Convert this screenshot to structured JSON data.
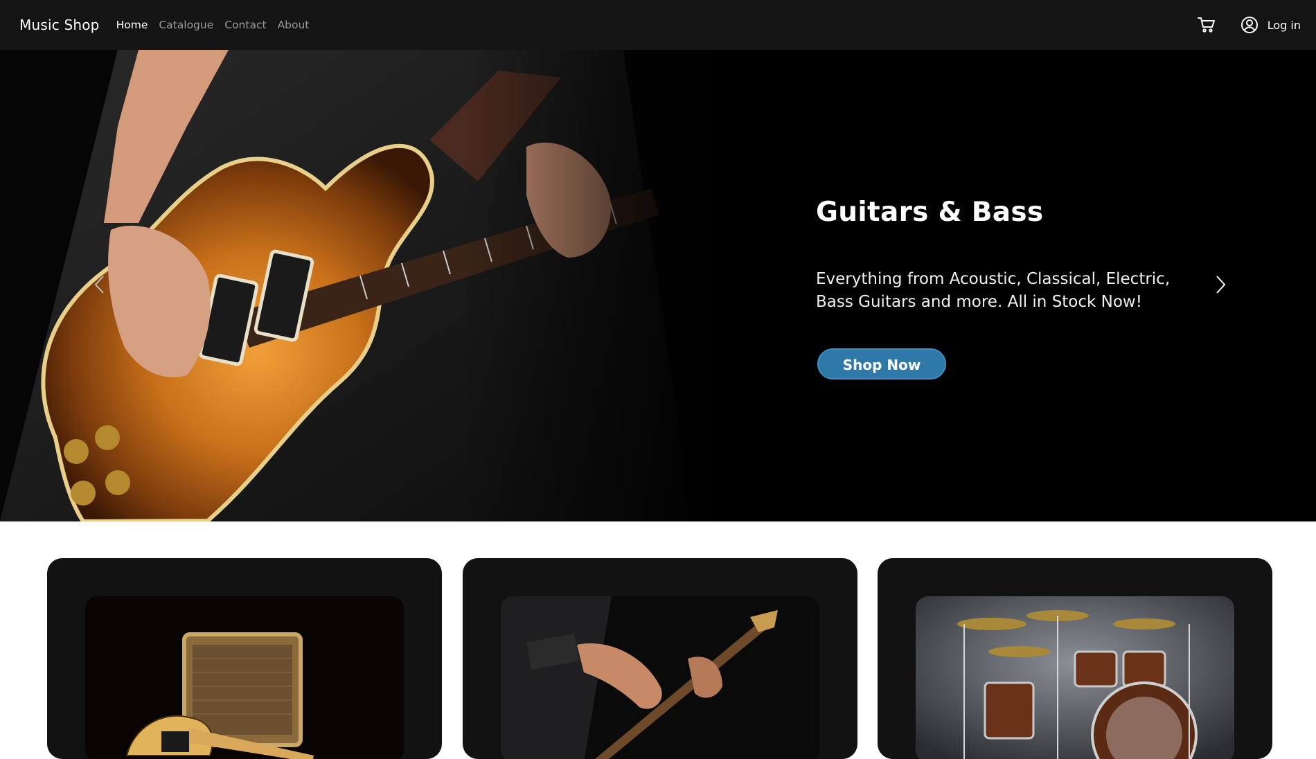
{
  "navbar": {
    "brand": "Music Shop",
    "links": [
      {
        "label": "Home",
        "active": true
      },
      {
        "label": "Catalogue",
        "active": false
      },
      {
        "label": "Contact",
        "active": false
      },
      {
        "label": "About",
        "active": false
      }
    ],
    "cart_icon": "cart-icon",
    "user_icon": "user-circle-icon",
    "login_label": "Log in"
  },
  "hero": {
    "title": "Guitars & Bass",
    "text": "Everything from Acoustic, Classical, Electric, Bass Guitars and more. All in Stock Now!",
    "button_label": "Shop Now",
    "prev_icon": "chevron-left-icon",
    "next_icon": "chevron-right-icon",
    "button_color": "#2e79a8"
  },
  "cards": [
    {
      "image": "electric-guitar-amp-image"
    },
    {
      "image": "bass-guitar-player-image"
    },
    {
      "image": "drum-kit-image"
    }
  ],
  "colors": {
    "navbar_bg": "#141414",
    "hero_bg": "#000000",
    "card_bg": "#121212"
  }
}
